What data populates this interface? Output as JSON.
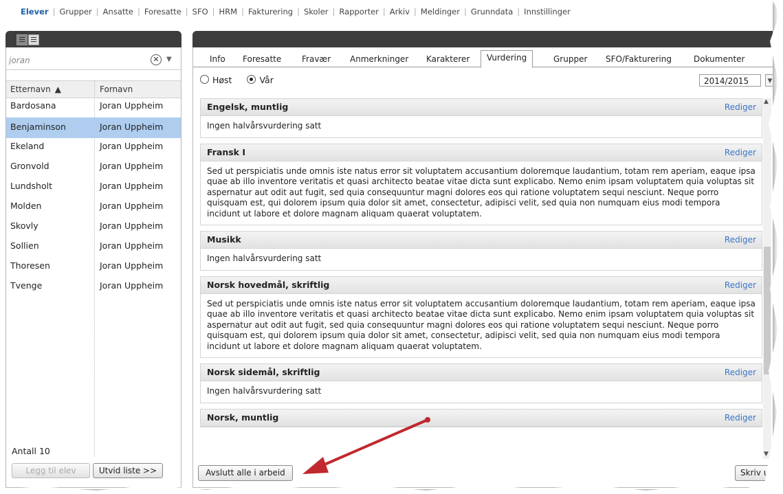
{
  "topnav": {
    "items": [
      "Elever",
      "Grupper",
      "Ansatte",
      "Foresatte",
      "SFO",
      "HRM",
      "Fakturering",
      "Skoler",
      "Rapporter",
      "Arkiv",
      "Meldinger",
      "Grunndata",
      "Innstillinger"
    ],
    "active": "Elever"
  },
  "left": {
    "search_value": "joran",
    "col_lastname": "Etternavn",
    "col_firstname": "Fornavn",
    "rows": [
      {
        "last": "Bardosana",
        "first": "Joran Uppheim"
      },
      {
        "last": "Benjaminson",
        "first": "Joran Uppheim"
      },
      {
        "last": "Ekeland",
        "first": "Joran Uppheim"
      },
      {
        "last": "Gronvold",
        "first": "Joran Uppheim"
      },
      {
        "last": "Lundsholt",
        "first": "Joran Uppheim"
      },
      {
        "last": "Molden",
        "first": "Joran Uppheim"
      },
      {
        "last": "Skovly",
        "first": "Joran Uppheim"
      },
      {
        "last": "Sollien",
        "first": "Joran Uppheim"
      },
      {
        "last": "Thoresen",
        "first": "Joran Uppheim"
      },
      {
        "last": "Tvenge",
        "first": "Joran Uppheim"
      }
    ],
    "selected_row": 1,
    "count_label": "Antall 10",
    "add_button": "Legg til elev",
    "expand_button": "Utvid liste >>"
  },
  "tabs": [
    "Info",
    "Foresatte",
    "Fravær",
    "Anmerkninger",
    "Karakterer",
    "Vurdering",
    "Grupper",
    "SFO/Fakturering",
    "Dokumenter"
  ],
  "active_tab": "Vurdering",
  "semester": {
    "autumn": "Høst",
    "spring": "Vår",
    "selected": "Vår"
  },
  "year": "2014/2015",
  "edit_label": "Rediger",
  "sections": [
    {
      "title": "Engelsk, muntlig",
      "body": "Ingen halvårsvurdering satt"
    },
    {
      "title": "Fransk I",
      "body": "Sed ut perspiciatis unde omnis iste natus error sit voluptatem accusantium doloremque laudantium, totam rem aperiam, eaque ipsa quae ab illo inventore veritatis et quasi architecto beatae vitae dicta sunt explicabo. Nemo enim ipsam voluptatem quia voluptas sit aspernatur aut odit aut fugit, sed quia consequuntur magni dolores eos qui ratione voluptatem sequi nesciunt. Neque porro quisquam est, qui dolorem ipsum quia dolor sit amet, consectetur, adipisci velit, sed quia non numquam eius modi tempora incidunt ut labore et dolore magnam aliquam quaerat voluptatem."
    },
    {
      "title": "Musikk",
      "body": "Ingen halvårsvurdering satt"
    },
    {
      "title": "Norsk hovedmål, skriftlig",
      "body": "Sed ut perspiciatis unde omnis iste natus error sit voluptatem accusantium doloremque laudantium, totam rem aperiam, eaque ipsa quae ab illo inventore veritatis et quasi architecto beatae vitae dicta sunt explicabo. Nemo enim ipsam voluptatem quia voluptas sit aspernatur aut odit aut fugit, sed quia consequuntur magni dolores eos qui ratione voluptatem sequi nesciunt. Neque porro quisquam est, qui dolorem ipsum quia dolor sit amet, consectetur, adipisci velit, sed quia non numquam eius modi tempora incidunt ut labore et dolore magnam aliquam quaerat voluptatem."
    },
    {
      "title": "Norsk sidemål, skriftlig",
      "body": "Ingen halvårsvurdering satt"
    },
    {
      "title": "Norsk, muntlig",
      "body": ""
    }
  ],
  "buttons": {
    "finish_all": "Avslutt alle i arbeid",
    "print": "Skriv ut"
  },
  "colors": {
    "accent": "#1e5fa8",
    "link": "#3a76c8",
    "selection": "#aecdef",
    "header_dark": "#3d3d3d",
    "arrow": "#c0282d"
  }
}
